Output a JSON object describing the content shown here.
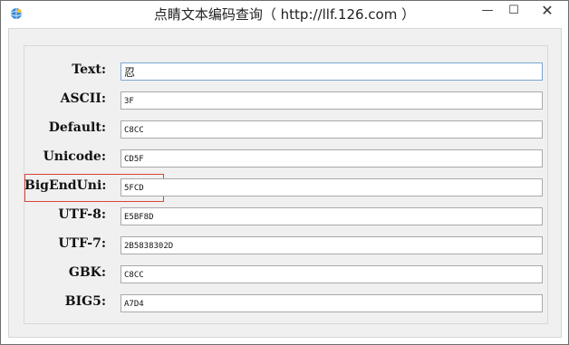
{
  "window": {
    "title": "点睛文本编码查询（ http://llf.126.com ）",
    "buttons": {
      "minimize": "—",
      "maximize": "☐",
      "close": "✕"
    }
  },
  "fields": [
    {
      "key": "text",
      "label": "Text:",
      "value": "忍"
    },
    {
      "key": "ascii",
      "label": "ASCII:",
      "value": "3F"
    },
    {
      "key": "default",
      "label": "Default:",
      "value": "C8CC"
    },
    {
      "key": "unicode",
      "label": "Unicode:",
      "value": "CD5F"
    },
    {
      "key": "bigenduni",
      "label": "BigEndUni:",
      "value": "5FCD"
    },
    {
      "key": "utf8",
      "label": "UTF-8:",
      "value": "E5BF8D"
    },
    {
      "key": "utf7",
      "label": "UTF-7:",
      "value": "2B5838302D"
    },
    {
      "key": "gbk",
      "label": "GBK:",
      "value": "C8CC"
    },
    {
      "key": "big5",
      "label": "BIG5:",
      "value": "A7D4"
    }
  ],
  "colors": {
    "highlight": "#d9443a",
    "focus_border": "#7aa4d1"
  }
}
